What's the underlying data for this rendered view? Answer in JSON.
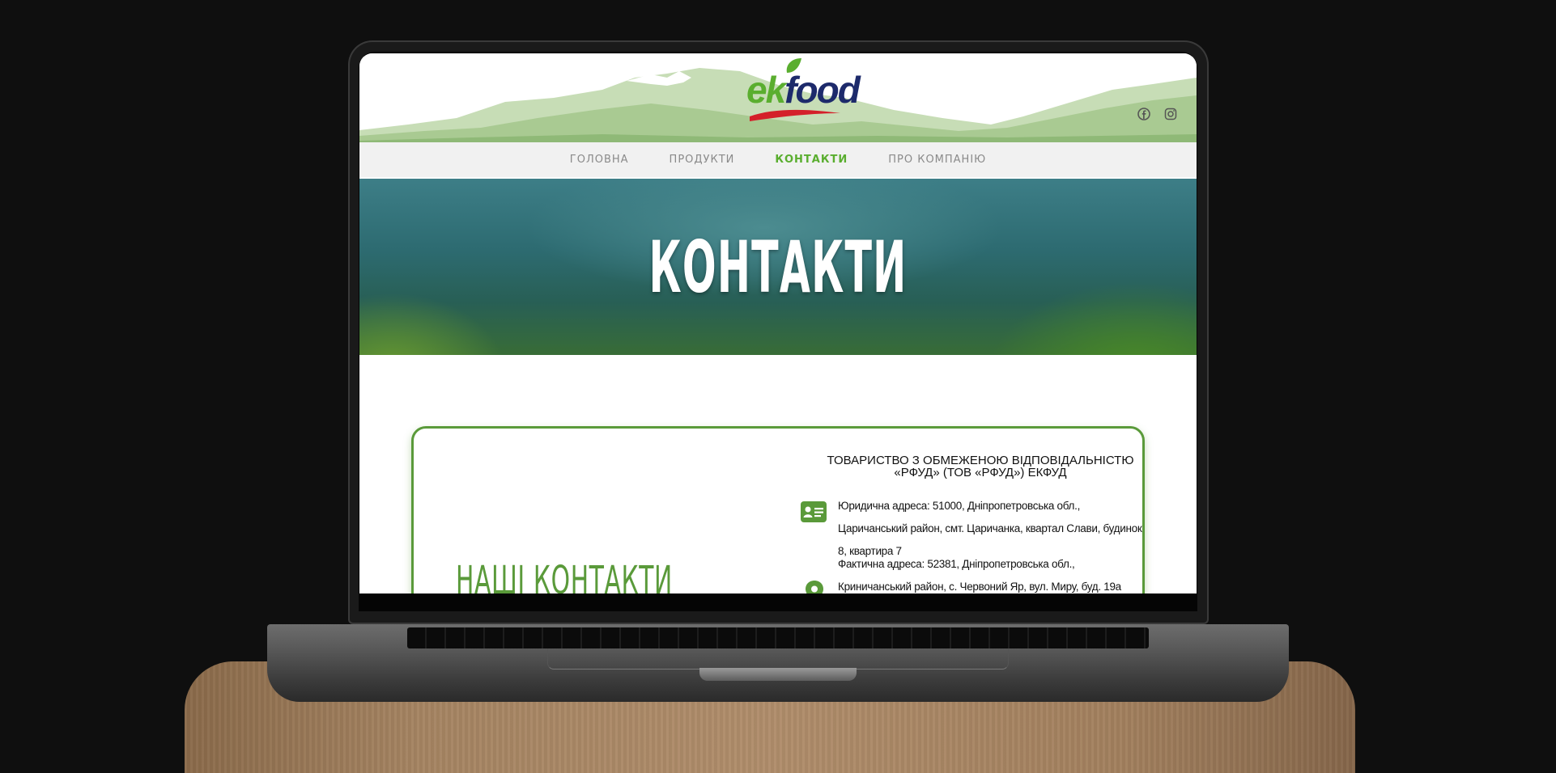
{
  "site": {
    "logo": {
      "part1": "ek",
      "part2": "food"
    },
    "social": [
      {
        "name": "facebook-icon"
      },
      {
        "name": "instagram-icon"
      }
    ]
  },
  "nav": {
    "items": [
      {
        "label": "ГОЛОВНА"
      },
      {
        "label": "ПРОДУКТИ"
      },
      {
        "label": "КОНТАКТИ",
        "active": true
      },
      {
        "label": "ПРО КОМПАНІЮ"
      }
    ]
  },
  "hero": {
    "title": "КОНТАКТИ"
  },
  "contacts": {
    "heading": "НАШІ КОНТАКТИ",
    "company_line1": "ТОВАРИСТВО З ОБМЕЖЕНОЮ ВІДПОВІДАЛЬНІСТЮ",
    "company_line2": "«РФУД» (ТОВ «РФУД») ЕКФУД",
    "legal_address": "Юридична адреса: 51000, Дніпропетровська обл., Царичанський район, смт. Царичанка, квартал Слави, будинок 8, квартира 7",
    "actual_address": "Фактична адреса: 52381, Дніпропетровська обл., Криничанський район, с. Червоний Яр, вул. Миру, буд. 19а"
  },
  "colors": {
    "accent": "#5aae2f",
    "card_border": "#5a9a3a",
    "logo_blue": "#1d2a6b",
    "logo_red": "#d4202a"
  }
}
